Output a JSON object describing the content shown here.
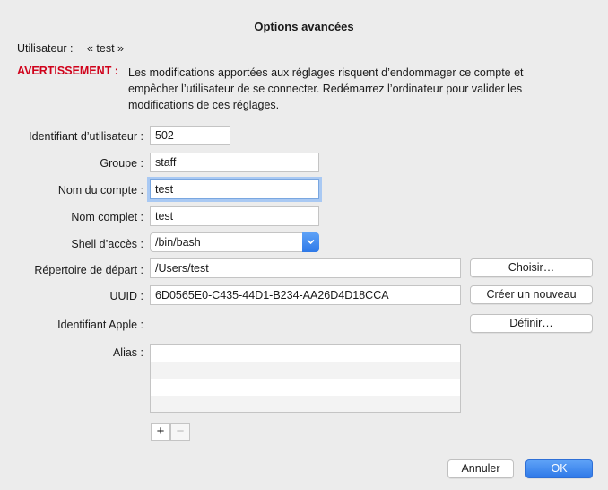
{
  "dialog": {
    "title": "Options avancées"
  },
  "user": {
    "label": "Utilisateur :",
    "value": "« test »"
  },
  "warning": {
    "label": "AVERTISSEMENT :",
    "lines": [
      "Les modifications apportées aux réglages risquent d’endommager ce compte et",
      "empêcher l’utilisateur de se connecter. Redémarrez l’ordinateur pour valider les",
      "modifications de ces réglages."
    ]
  },
  "fields": {
    "user_id": {
      "label": "Identifiant d’utilisateur :",
      "value": "502"
    },
    "group": {
      "label": "Groupe :",
      "value": "staff"
    },
    "account_name": {
      "label": "Nom du compte :",
      "value": "test"
    },
    "full_name": {
      "label": "Nom complet :",
      "value": "test"
    },
    "shell": {
      "label": "Shell d’accès :",
      "value": "/bin/bash"
    },
    "home_dir": {
      "label": "Répertoire de départ :",
      "value": "/Users/test",
      "button": "Choisir…"
    },
    "uuid": {
      "label": "UUID :",
      "value": "6D0565E0-C435-44D1-B234-AA26D4D18CCA",
      "button": "Créer un nouveau"
    },
    "apple_id": {
      "label": "Identifiant Apple :",
      "button": "Définir…"
    },
    "alias": {
      "label": "Alias :",
      "add": "+",
      "remove": "−"
    }
  },
  "footer": {
    "cancel": "Annuler",
    "ok": "OK"
  },
  "colors": {
    "warning": "#d0021b",
    "accent": "#2f79e8",
    "focus_ring": "#a9c9f3"
  }
}
